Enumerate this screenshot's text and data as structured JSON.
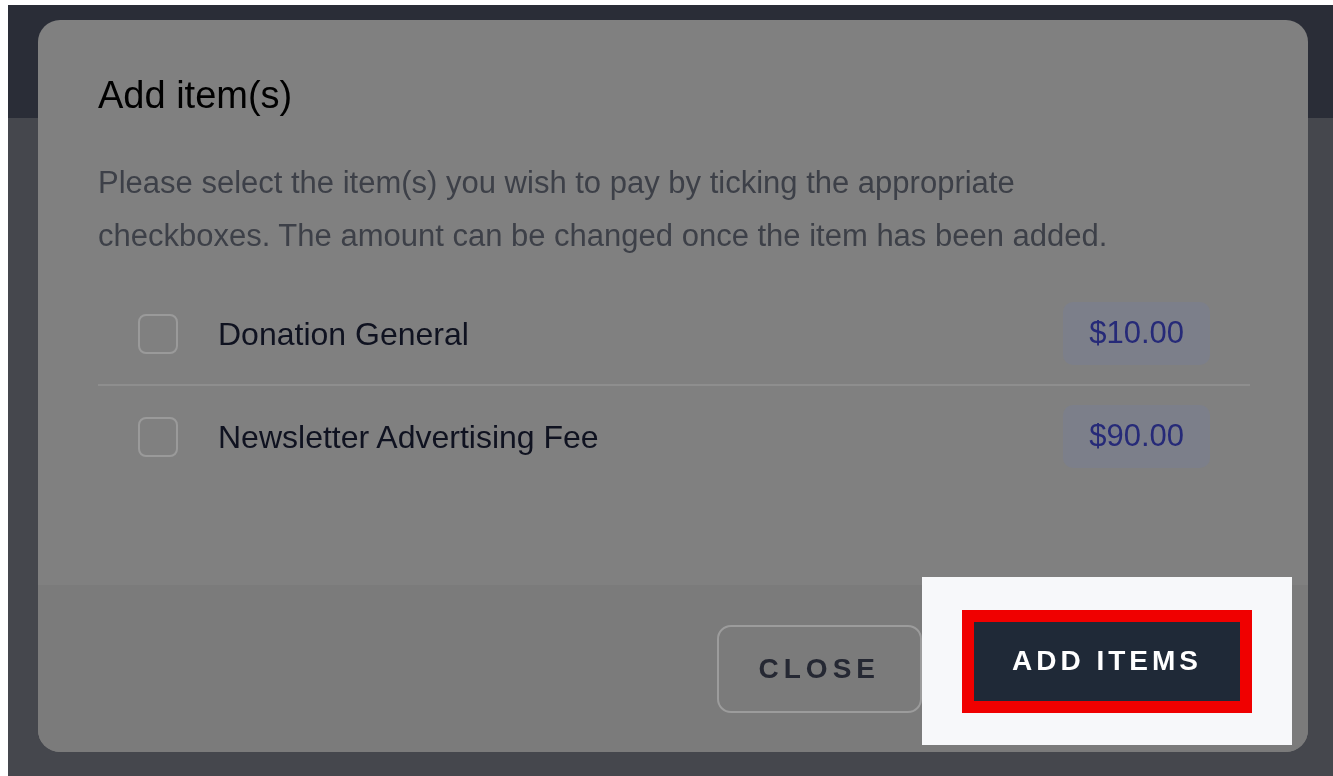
{
  "dialog": {
    "title": "Add item(s)",
    "description": "Please select the item(s) you wish to pay by ticking the appropriate checkboxes. The amount can be changed once the item has been added.",
    "items": [
      {
        "label": "Donation General",
        "amount": "$10.00",
        "checked": false
      },
      {
        "label": "Newsletter Advertising Fee",
        "amount": "$90.00",
        "checked": false
      }
    ],
    "buttons": [
      {
        "kind": "secondary",
        "label": "CLOSE"
      },
      {
        "kind": "primary",
        "label": "ADD ITEMS",
        "highlighted": true
      }
    ]
  }
}
